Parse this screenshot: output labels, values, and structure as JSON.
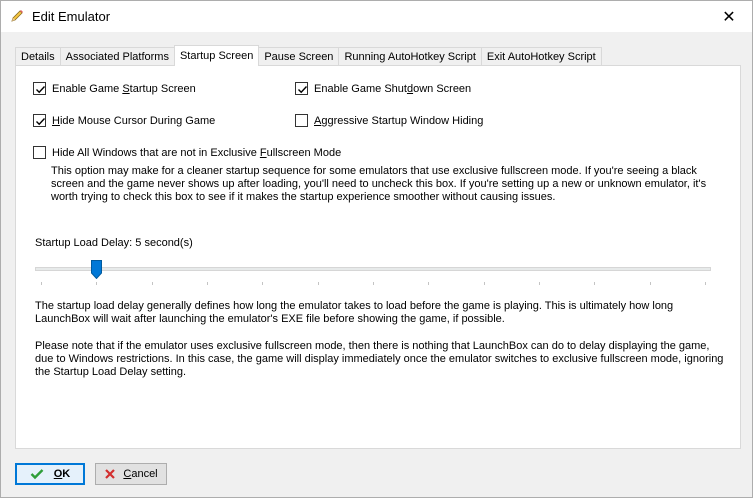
{
  "window": {
    "title": "Edit Emulator",
    "close_glyph": "✕"
  },
  "tabs": [
    {
      "label": "Details"
    },
    {
      "label": "Associated Platforms"
    },
    {
      "label": "Startup Screen",
      "active": true
    },
    {
      "label": "Pause Screen"
    },
    {
      "label": "Running AutoHotkey Script"
    },
    {
      "label": "Exit AutoHotkey Script"
    }
  ],
  "options": {
    "enable_startup": {
      "pre": "Enable Game ",
      "u": "S",
      "post": "tartup Screen",
      "checked": true
    },
    "enable_shutdown": {
      "pre": "Enable Game Shut",
      "u": "d",
      "post": "own Screen",
      "checked": true
    },
    "hide_cursor": {
      "pre": "",
      "u": "H",
      "post": "ide Mouse Cursor During Game",
      "checked": true
    },
    "aggressive_hiding": {
      "pre": "",
      "u": "A",
      "post": "ggressive Startup Window Hiding",
      "checked": false
    },
    "hide_windows": {
      "pre": "Hide All Windows that are not in Exclusive ",
      "u": "F",
      "post": "ullscreen Mode",
      "checked": false
    }
  },
  "hide_windows_description": "This option may make for a cleaner startup sequence for some emulators that use exclusive fullscreen mode. If you're seeing a black screen and the game never shows up after loading, you'll need to uncheck this box. If you're setting up a new or unknown emulator, it's worth trying to check this box to see if it makes the startup experience smoother without causing issues.",
  "slider": {
    "label": "Startup Load Delay: 5 second(s)",
    "value": 5,
    "min": 0,
    "max": 60
  },
  "info_paragraph_1": "The startup load delay generally defines how long the emulator takes to load before the game is playing. This is ultimately how long LaunchBox will wait after launching the emulator's EXE file before showing the game, if possible.",
  "info_paragraph_2": "Please note that if the emulator uses exclusive fullscreen mode, then there is nothing that LaunchBox can do to delay displaying the game, due to Windows restrictions. In this case, the game will display immediately once the emulator switches to exclusive fullscreen mode, ignoring the Startup Load Delay setting.",
  "buttons": {
    "ok": {
      "u": "O",
      "post": "K"
    },
    "cancel": {
      "u": "C",
      "post": "ancel"
    }
  },
  "colors": {
    "accent": "#0078d7",
    "ok_check": "#2e9e3a",
    "cancel_x": "#d32f2f"
  }
}
